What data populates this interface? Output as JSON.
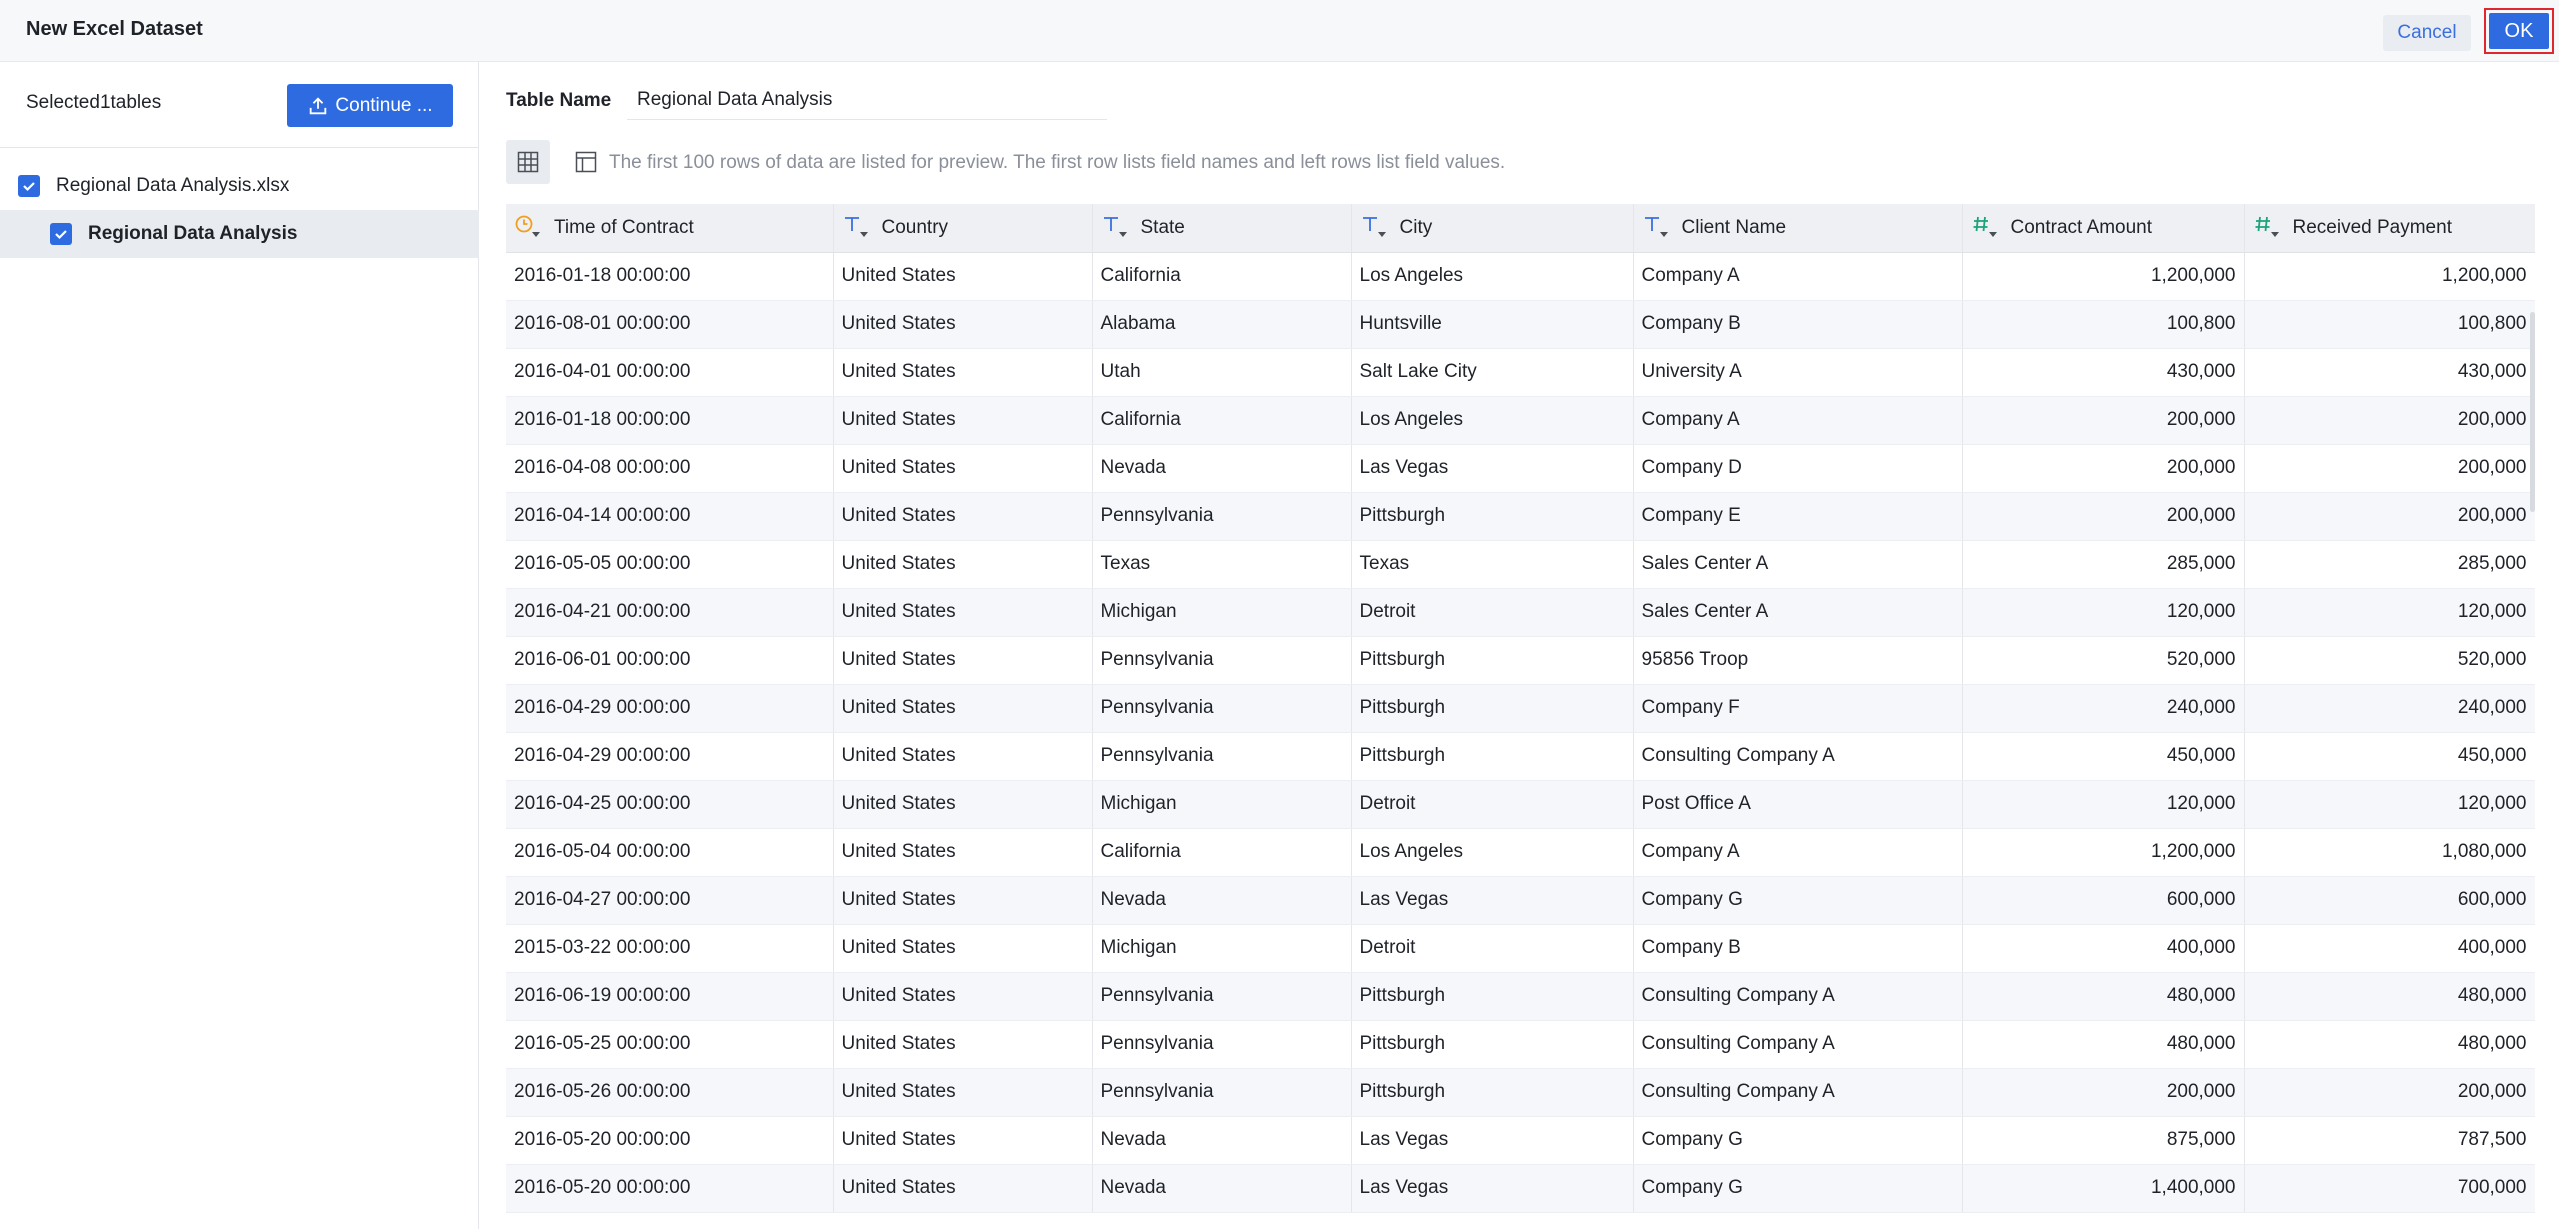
{
  "header": {
    "title": "New Excel Dataset",
    "cancel_label": "Cancel",
    "ok_label": "OK"
  },
  "sidebar": {
    "selected_label": "Selected1tables",
    "continue_label": "Continue ...",
    "file_name": "Regional Data Analysis.xlsx",
    "table_name": "Regional Data Analysis"
  },
  "main": {
    "table_name_label": "Table Name",
    "table_name_value": "Regional Data Analysis",
    "preview_note": "The first 100 rows of data are listed for preview. The first row lists field names and left rows list field values."
  },
  "colors": {
    "accent": "#2f6be0",
    "date_icon": "#f0a020",
    "text_icon": "#3a6fe0",
    "number_icon": "#1aa37a",
    "ok_highlight": "#e0262f"
  },
  "columns": [
    {
      "label": "Time of Contract",
      "icon": "clock-icon",
      "type": "date"
    },
    {
      "label": "Country",
      "icon": "text-type-icon",
      "type": "text"
    },
    {
      "label": "State",
      "icon": "text-type-icon",
      "type": "text"
    },
    {
      "label": "City",
      "icon": "text-type-icon",
      "type": "text"
    },
    {
      "label": "Client Name",
      "icon": "text-type-icon",
      "type": "text"
    },
    {
      "label": "Contract Amount",
      "icon": "number-type-icon",
      "type": "number"
    },
    {
      "label": "Received Payment",
      "icon": "number-type-icon",
      "type": "number"
    }
  ],
  "rows": [
    [
      "2016-01-18 00:00:00",
      "United States",
      "California",
      "Los Angeles",
      "Company A",
      "1,200,000",
      "1,200,000"
    ],
    [
      "2016-08-01 00:00:00",
      "United States",
      "Alabama",
      "Huntsville",
      "Company B",
      "100,800",
      "100,800"
    ],
    [
      "2016-04-01 00:00:00",
      "United States",
      "Utah",
      "Salt Lake City",
      "University A",
      "430,000",
      "430,000"
    ],
    [
      "2016-01-18 00:00:00",
      "United States",
      "California",
      "Los Angeles",
      "Company A",
      "200,000",
      "200,000"
    ],
    [
      "2016-04-08 00:00:00",
      "United States",
      "Nevada",
      "Las Vegas",
      "Company D",
      "200,000",
      "200,000"
    ],
    [
      "2016-04-14 00:00:00",
      "United States",
      " Pennsylvania",
      " Pittsburgh",
      "Company E",
      "200,000",
      "200,000"
    ],
    [
      "2016-05-05 00:00:00",
      "United States",
      "Texas",
      "Texas",
      "Sales Center A",
      "285,000",
      "285,000"
    ],
    [
      "2016-04-21 00:00:00",
      "United States",
      "Michigan",
      "Detroit",
      "Sales Center A",
      "120,000",
      "120,000"
    ],
    [
      "2016-06-01 00:00:00",
      "United States",
      " Pennsylvania",
      " Pittsburgh",
      "95856 Troop",
      "520,000",
      "520,000"
    ],
    [
      "2016-04-29 00:00:00",
      "United States",
      " Pennsylvania",
      " Pittsburgh",
      "Company F",
      "240,000",
      "240,000"
    ],
    [
      "2016-04-29 00:00:00",
      "United States",
      " Pennsylvania",
      " Pittsburgh",
      "Consulting Company A",
      "450,000",
      "450,000"
    ],
    [
      "2016-04-25 00:00:00",
      "United States",
      "Michigan",
      "Detroit",
      "Post Office A",
      "120,000",
      "120,000"
    ],
    [
      "2016-05-04 00:00:00",
      "United States",
      "California",
      "Los Angeles",
      "Company A",
      "1,200,000",
      "1,080,000"
    ],
    [
      "2016-04-27 00:00:00",
      "United States",
      "Nevada",
      "Las Vegas",
      "Company G",
      "600,000",
      "600,000"
    ],
    [
      "2015-03-22 00:00:00",
      "United States",
      "Michigan",
      "Detroit",
      "Company B",
      "400,000",
      "400,000"
    ],
    [
      "2016-06-19 00:00:00",
      "United States",
      " Pennsylvania",
      " Pittsburgh",
      "Consulting Company A",
      "480,000",
      "480,000"
    ],
    [
      "2016-05-25 00:00:00",
      "United States",
      " Pennsylvania",
      " Pittsburgh",
      "Consulting Company A",
      "480,000",
      "480,000"
    ],
    [
      "2016-05-26 00:00:00",
      "United States",
      " Pennsylvania",
      " Pittsburgh",
      "Consulting Company A",
      "200,000",
      "200,000"
    ],
    [
      "2016-05-20 00:00:00",
      "United States",
      "Nevada",
      "Las Vegas",
      "Company G",
      "875,000",
      "787,500"
    ],
    [
      "2016-05-20 00:00:00",
      "United States",
      "Nevada",
      "Las Vegas",
      "Company G",
      "1,400,000",
      "700,000"
    ]
  ]
}
